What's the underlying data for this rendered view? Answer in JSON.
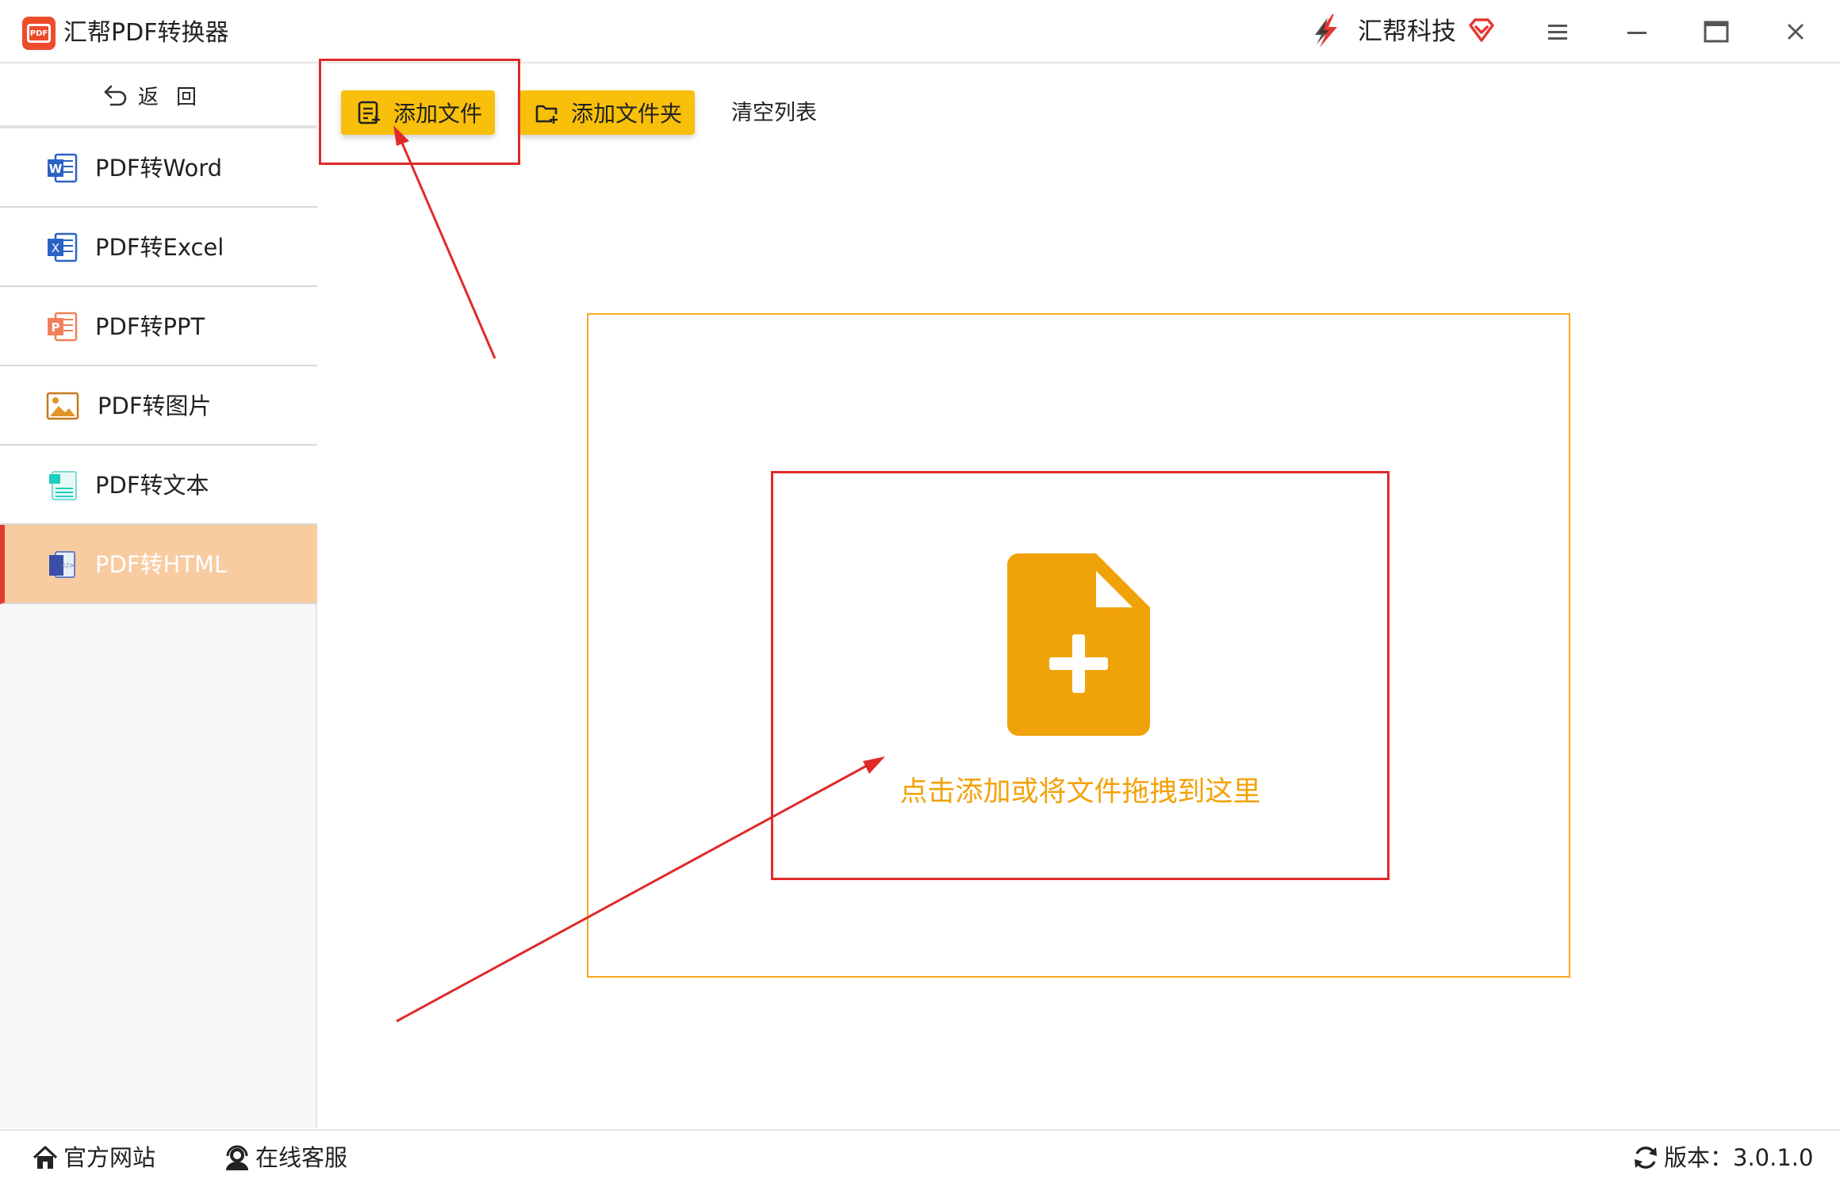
{
  "app": {
    "title": "汇帮PDF转换器",
    "logo_text": "PDF"
  },
  "brand": {
    "name": "汇帮科技"
  },
  "sidebar": {
    "back_label": "返回",
    "items": [
      {
        "label": "PDF转Word",
        "icon": "word-icon"
      },
      {
        "label": "PDF转Excel",
        "icon": "excel-icon"
      },
      {
        "label": "PDF转PPT",
        "icon": "ppt-icon"
      },
      {
        "label": "PDF转图片",
        "icon": "image-icon"
      },
      {
        "label": "PDF转文本",
        "icon": "text-icon"
      },
      {
        "label": "PDF转HTML",
        "icon": "html-icon",
        "active": true
      }
    ]
  },
  "toolbar": {
    "add_file_label": "添加文件",
    "add_folder_label": "添加文件夹",
    "clear_list_label": "清空列表"
  },
  "dropzone": {
    "hint": "点击添加或将文件拖拽到这里"
  },
  "statusbar": {
    "website_label": "官方网站",
    "support_label": "在线客服",
    "version_label": "版本：3.0.1.0"
  },
  "colors": {
    "accent_yellow": "#f8c00a",
    "drop_orange": "#f2a20a",
    "annotation_red": "#e02a2a",
    "active_nav": "#f8cba0"
  }
}
